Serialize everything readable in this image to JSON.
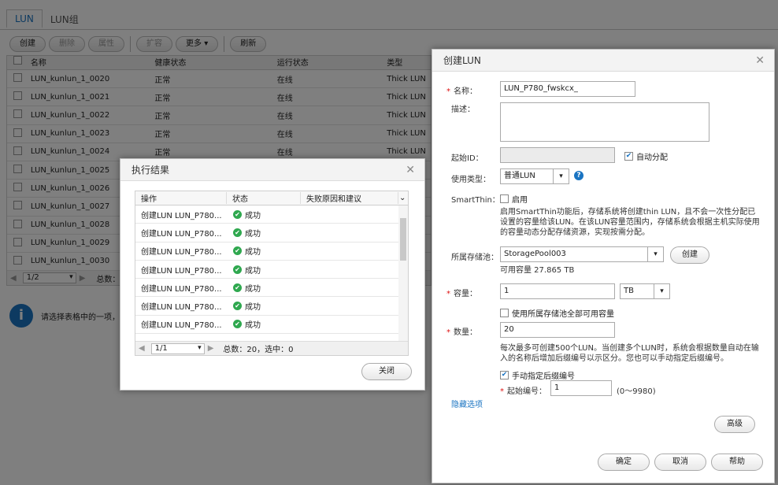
{
  "tabs": [
    "LUN",
    "LUN组"
  ],
  "toolbar": {
    "create": "创建",
    "delete": "删除",
    "props": "属性",
    "expand": "扩容",
    "more": "更多",
    "refresh": "刷新"
  },
  "grid": {
    "headers": [
      "名称",
      "健康状态",
      "运行状态",
      "类型"
    ],
    "rows": [
      [
        "LUN_kunlun_1_0020",
        "正常",
        "在线",
        "Thick LUN"
      ],
      [
        "LUN_kunlun_1_0021",
        "正常",
        "在线",
        "Thick LUN"
      ],
      [
        "LUN_kunlun_1_0022",
        "正常",
        "在线",
        "Thick LUN"
      ],
      [
        "LUN_kunlun_1_0023",
        "正常",
        "在线",
        "Thick LUN"
      ],
      [
        "LUN_kunlun_1_0024",
        "正常",
        "在线",
        "Thick LUN"
      ],
      [
        "LUN_kunlun_1_0025",
        "",
        "",
        ""
      ],
      [
        "LUN_kunlun_1_0026",
        "",
        "",
        ""
      ],
      [
        "LUN_kunlun_1_0027",
        "",
        "",
        ""
      ],
      [
        "LUN_kunlun_1_0028",
        "",
        "",
        ""
      ],
      [
        "LUN_kunlun_1_0029",
        "",
        "",
        ""
      ],
      [
        "LUN_kunlun_1_0030",
        "",
        "",
        ""
      ]
    ],
    "page": "1/2",
    "total": "总数："
  },
  "info_text": "请选择表格中的一项，"
}
